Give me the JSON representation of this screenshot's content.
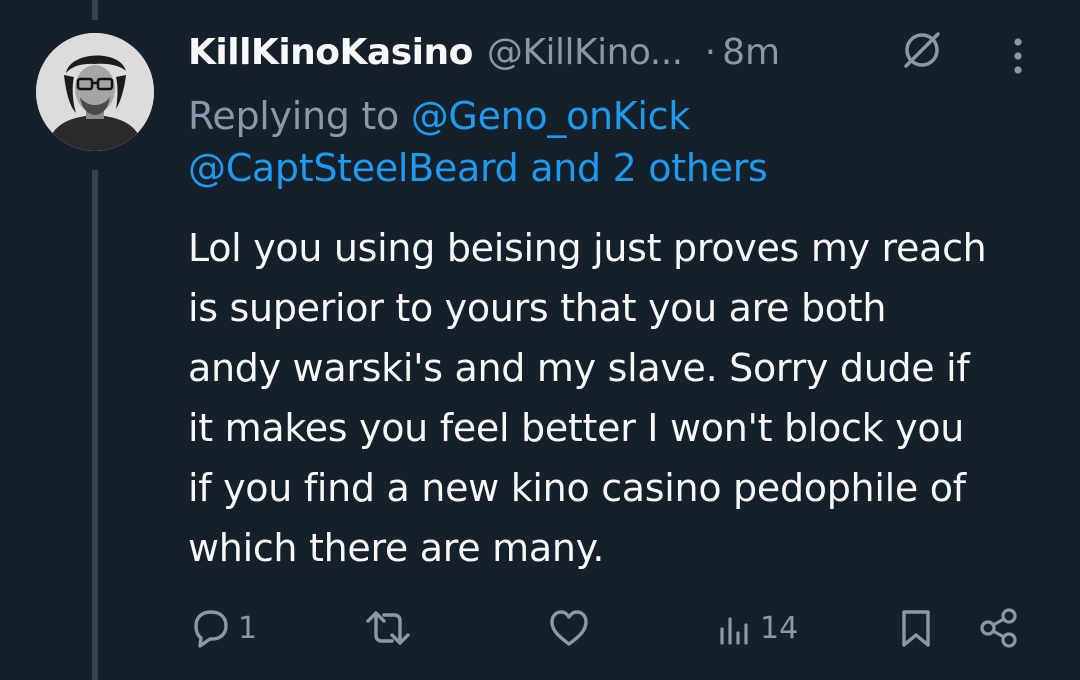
{
  "tweet": {
    "display_name": "KillKinoKasino",
    "handle": "@KillKino...",
    "separator": "·",
    "time": "8m",
    "replying_prefix": "Replying to ",
    "replying_mention_1": "@Geno_onKick",
    "replying_line_2": "@CaptSteelBeard and 2 others",
    "text_lines": [
      "Lol you using beising just proves my reach",
      "is superior to yours that you are both",
      "andy warski's and my slave. Sorry dude if",
      "it makes you feel better I won't block you",
      "if you find a new kino casino pedophile of",
      "which there are many."
    ]
  },
  "actions": {
    "reply_count": "1",
    "retweet_count": "",
    "like_count": "",
    "views_count": "14"
  },
  "icons": {
    "avatar": "avatar",
    "grok": "grok-icon",
    "more": "more-icon",
    "reply": "reply-icon",
    "retweet": "retweet-icon",
    "like": "like-icon",
    "views": "views-icon",
    "bookmark": "bookmark-icon",
    "share": "share-icon"
  },
  "colors": {
    "background": "#15202b",
    "text": "#f7f9f9",
    "secondary": "#8b98a5",
    "link": "#1d9bf0",
    "thread_line": "#38444d"
  }
}
